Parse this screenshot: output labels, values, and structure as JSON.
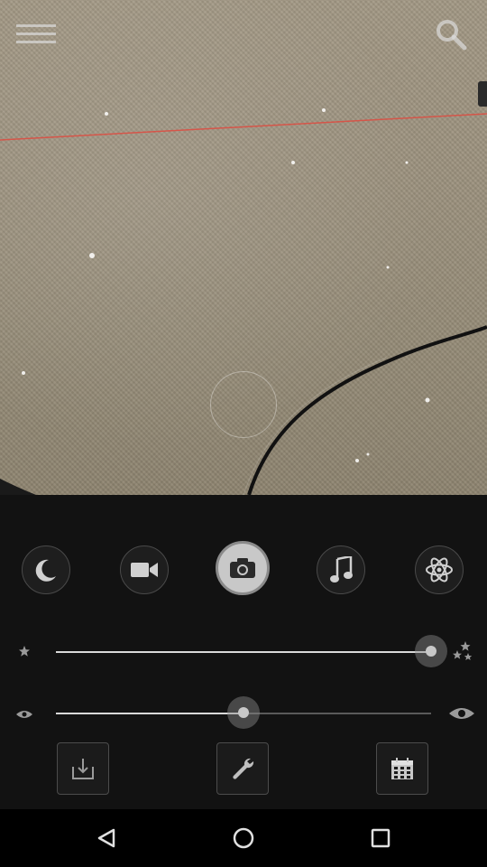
{
  "preview": {
    "menu_icon": "hamburger-menu-icon",
    "search_icon": "search-icon",
    "focus_indicator": "focus-circle"
  },
  "modes": [
    {
      "name": "night",
      "icon": "moon-icon",
      "active": false
    },
    {
      "name": "video",
      "icon": "video-camera-icon",
      "active": false
    },
    {
      "name": "photo",
      "icon": "camera-icon",
      "active": true
    },
    {
      "name": "music",
      "icon": "music-note-icon",
      "active": false
    },
    {
      "name": "atom",
      "icon": "atom-icon",
      "active": false
    }
  ],
  "sliders": {
    "brightness": {
      "icon_min": "star-small-icon",
      "icon_max": "stars-icon",
      "value": 1.0
    },
    "exposure": {
      "icon_min": "eye-small-icon",
      "icon_max": "eye-large-icon",
      "value": 0.5
    }
  },
  "tools": [
    {
      "name": "download",
      "icon": "download-icon"
    },
    {
      "name": "settings",
      "icon": "wrench-icon"
    },
    {
      "name": "calendar",
      "icon": "calendar-icon"
    }
  ],
  "navbar": {
    "back_icon": "back-triangle-icon",
    "home_icon": "home-circle-icon",
    "recents_icon": "recents-square-icon"
  },
  "colors": {
    "panel_bg": "#121212",
    "laser_line": "#e04a3f"
  }
}
